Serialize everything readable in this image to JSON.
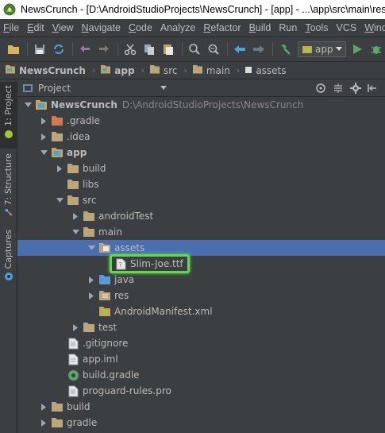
{
  "window": {
    "title": "NewsCrunch - [D:\\AndroidStudioProjects\\NewsCrunch] - [app] - ...\\app\\src\\main\\res\\la"
  },
  "menu": [
    {
      "id": "file",
      "label": "File",
      "mnemonic": "F",
      "rest": "ile"
    },
    {
      "id": "edit",
      "label": "Edit",
      "mnemonic": "E",
      "rest": "dit"
    },
    {
      "id": "view",
      "label": "View",
      "mnemonic": "V",
      "rest": "iew"
    },
    {
      "id": "navigate",
      "label": "Navigate",
      "mnemonic": "N",
      "rest": "avigate"
    },
    {
      "id": "code",
      "label": "Code",
      "mnemonic": "C",
      "rest": "ode"
    },
    {
      "id": "analyze",
      "label": "Analyze",
      "mnemonic": "",
      "rest": "Analyze"
    },
    {
      "id": "refactor",
      "label": "Refactor",
      "mnemonic": "R",
      "rest": "efactor"
    },
    {
      "id": "build",
      "label": "Build",
      "mnemonic": "B",
      "rest": "uild"
    },
    {
      "id": "run",
      "label": "Run",
      "mnemonic": "",
      "rest": "Run"
    },
    {
      "id": "tools",
      "label": "Tools",
      "mnemonic": "T",
      "rest": "ools"
    },
    {
      "id": "vcs",
      "label": "VCS",
      "mnemonic": "",
      "rest": "VCS"
    },
    {
      "id": "window",
      "label": "Wind",
      "mnemonic": "W",
      "rest": "ind"
    }
  ],
  "toolbar": {
    "run_config": "app"
  },
  "breadcrumb": [
    {
      "label": "NewsCrunch",
      "type": "module",
      "bold": true
    },
    {
      "label": "app",
      "type": "module",
      "bold": true
    },
    {
      "label": "src",
      "type": "folder",
      "bold": false
    },
    {
      "label": "main",
      "type": "folder",
      "bold": false
    },
    {
      "label": "assets",
      "type": "assets",
      "bold": false
    }
  ],
  "left_strip": {
    "project": "1: Project",
    "structure": "7: Structure",
    "captures": "Captures"
  },
  "panel": {
    "view_label": "Project"
  },
  "tree": [
    {
      "depth": 0,
      "arrow": "down",
      "icon": "module-folder-icon",
      "name": "NewsCrunch",
      "path": "D:\\AndroidStudioProjects\\NewsCrunch",
      "bold": true
    },
    {
      "depth": 1,
      "arrow": "right",
      "icon": "folder-orange-icon",
      "name": ".gradle"
    },
    {
      "depth": 1,
      "arrow": "right",
      "icon": "folder-icon",
      "name": ".idea"
    },
    {
      "depth": 1,
      "arrow": "down",
      "icon": "module-folder-icon",
      "name": "app",
      "bold": true
    },
    {
      "depth": 2,
      "arrow": "right",
      "icon": "folder-icon",
      "name": "build"
    },
    {
      "depth": 2,
      "arrow": "none",
      "icon": "folder-icon",
      "name": "libs"
    },
    {
      "depth": 2,
      "arrow": "down",
      "icon": "folder-icon",
      "name": "src"
    },
    {
      "depth": 3,
      "arrow": "right",
      "icon": "folder-icon",
      "name": "androidTest"
    },
    {
      "depth": 3,
      "arrow": "down",
      "icon": "folder-icon",
      "name": "main"
    },
    {
      "depth": 4,
      "arrow": "down",
      "icon": "assets-folder-icon",
      "name": "assets",
      "selected": true
    },
    {
      "depth": 5,
      "arrow": "none",
      "icon": "unknown-file-icon",
      "name": "Slim-Joe.ttf",
      "highlighted": true
    },
    {
      "depth": 4,
      "arrow": "right",
      "icon": "source-folder-icon",
      "name": "java"
    },
    {
      "depth": 4,
      "arrow": "right",
      "icon": "resource-folder-icon",
      "name": "res"
    },
    {
      "depth": 4,
      "arrow": "none",
      "icon": "manifest-file-icon",
      "name": "AndroidManifest.xml"
    },
    {
      "depth": 3,
      "arrow": "right",
      "icon": "folder-icon",
      "name": "test"
    },
    {
      "depth": 2,
      "arrow": "none",
      "icon": "text-file-icon",
      "name": ".gitignore"
    },
    {
      "depth": 2,
      "arrow": "none",
      "icon": "iml-file-icon",
      "name": "app.iml"
    },
    {
      "depth": 2,
      "arrow": "none",
      "icon": "gradle-file-icon",
      "name": "build.gradle"
    },
    {
      "depth": 2,
      "arrow": "none",
      "icon": "text-file-icon",
      "name": "proguard-rules.pro"
    },
    {
      "depth": 1,
      "arrow": "right",
      "icon": "folder-icon",
      "name": "build"
    },
    {
      "depth": 1,
      "arrow": "right",
      "icon": "folder-icon",
      "name": "gradle"
    }
  ],
  "colors": {
    "background": "#3c3f41",
    "selection": "#4b6eaf",
    "highlight": "#62d84e",
    "folder": "#b9a77b",
    "source_folder": "#5a9bd5"
  }
}
